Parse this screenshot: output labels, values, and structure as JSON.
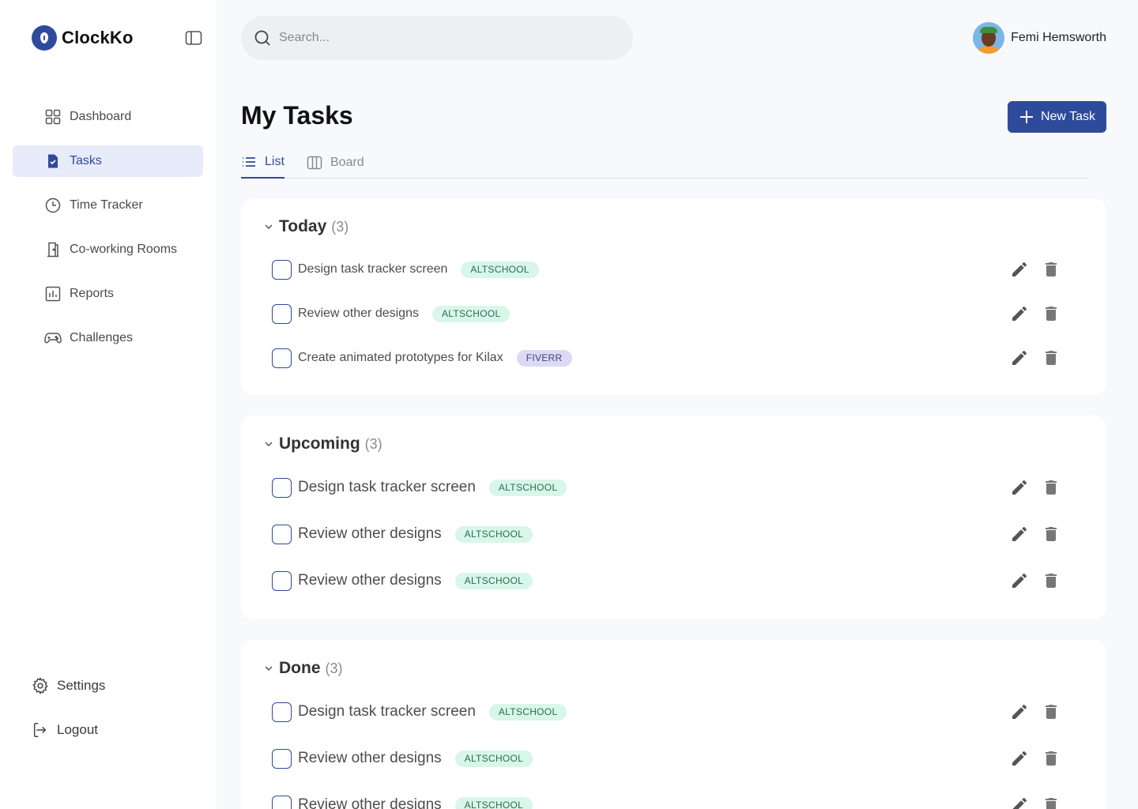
{
  "app": {
    "name": "ClockKo"
  },
  "search": {
    "placeholder": "Search..."
  },
  "user": {
    "name": "Femi Hemsworth"
  },
  "nav": [
    {
      "label": "Dashboard",
      "icon": "grid-icon"
    },
    {
      "label": "Tasks",
      "icon": "task-file-icon",
      "active": true
    },
    {
      "label": "Time Tracker",
      "icon": "clock-icon"
    },
    {
      "label": "Co-working Rooms",
      "icon": "door-icon"
    },
    {
      "label": "Reports",
      "icon": "bar-chart-icon"
    },
    {
      "label": "Challenges",
      "icon": "gamepad-icon"
    }
  ],
  "bottom_nav": {
    "settings": "Settings",
    "logout": "Logout"
  },
  "page": {
    "title": "My Tasks",
    "new_task": "New Task"
  },
  "tabs": {
    "list": "List",
    "board": "Board"
  },
  "sections": [
    {
      "title": "Today",
      "count": "(3)",
      "tasks": [
        {
          "label": "Design task tracker screen",
          "tag": "ALTSCHOOL"
        },
        {
          "label": "Review other designs",
          "tag": "ALTSCHOOL"
        },
        {
          "label": "Create animated prototypes for Kilax",
          "tag": "FIVERR"
        }
      ]
    },
    {
      "title": "Upcoming",
      "count": "(3)",
      "tasks": [
        {
          "label": "Design task tracker screen",
          "tag": "ALTSCHOOL"
        },
        {
          "label": "Review other designs",
          "tag": "ALTSCHOOL"
        },
        {
          "label": "Review other designs",
          "tag": "ALTSCHOOL"
        }
      ]
    },
    {
      "title": "Done",
      "count": "(3)",
      "tasks": [
        {
          "label": "Design task tracker screen",
          "tag": "ALTSCHOOL"
        },
        {
          "label": "Review other designs",
          "tag": "ALTSCHOOL"
        },
        {
          "label": "Review other designs",
          "tag": "ALTSCHOOL"
        }
      ]
    }
  ],
  "colors": {
    "brand": "#2e4a9b",
    "active_bg": "#e8ebfa",
    "tag_altschool": "#d8f6ea",
    "tag_fiverr": "#dcd9f3",
    "page_bg": "#f8f9fc"
  }
}
